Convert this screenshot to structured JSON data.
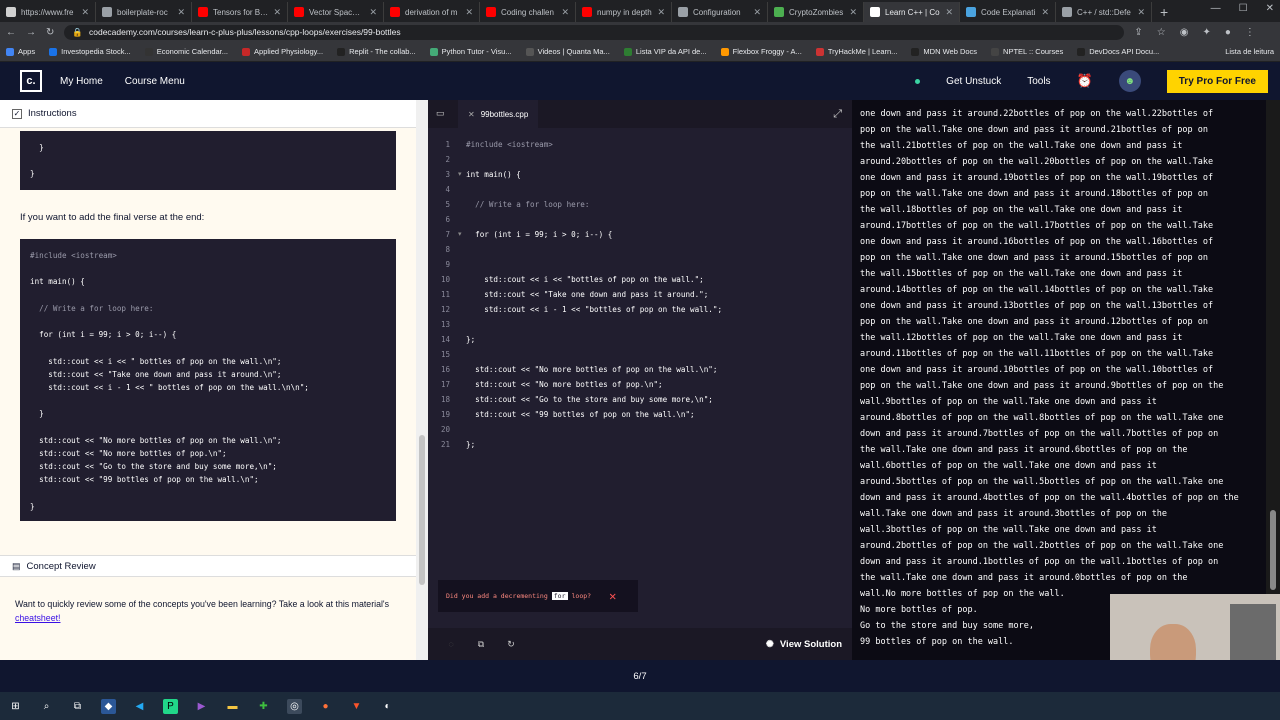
{
  "browser": {
    "tabs": [
      {
        "label": "https://www.fre",
        "color": "#d0d0d0"
      },
      {
        "label": "boilerplate-roc",
        "color": "#9aa0a6"
      },
      {
        "label": "Tensors for Begi",
        "color": "#ff0000"
      },
      {
        "label": "Vector Space M",
        "color": "#ff0000"
      },
      {
        "label": "derivation of m",
        "color": "#ff0000"
      },
      {
        "label": "Coding challen",
        "color": "#ff0000"
      },
      {
        "label": "numpy in depth",
        "color": "#ff0000"
      },
      {
        "label": "Configuration",
        "color": "#9aa0a6"
      },
      {
        "label": "CryptoZombies",
        "color": "#4caf50"
      },
      {
        "label": "Learn C++ | Co",
        "color": "#ffffff"
      },
      {
        "label": "Code Explanati",
        "color": "#4aa3df"
      },
      {
        "label": "C++ / std::Defe",
        "color": "#9aa0a6"
      }
    ],
    "url": "codecademy.com/courses/learn-c-plus-plus/lessons/cpp-loops/exercises/99-bottles",
    "bookmarks": [
      "Apps",
      "Investopedia Stock...",
      "Economic Calendar...",
      "Applied Physiology...",
      "Replit - The collab...",
      "Python Tutor - Visu...",
      "Videos | Quanta Ma...",
      "Lista VIP da API de...",
      "Flexbox Froggy - A...",
      "TryHackMe | Learn...",
      "MDN Web Docs",
      "NPTEL :: Courses",
      "DevDocs API Docu..."
    ],
    "bookmark_right": "Lista de leitura"
  },
  "header": {
    "logo": "c.",
    "home": "My Home",
    "menu": "Course Menu",
    "unstuck": "Get Unstuck",
    "tools": "Tools",
    "pro": "Try Pro For Free"
  },
  "instructions": {
    "title": "Instructions",
    "prev_block": [
      "  }",
      "",
      "}"
    ],
    "final_verse_text": "If you want to add the final verse at the end:",
    "code": [
      "#include <iostream>",
      "",
      "int main() {",
      "",
      "  // Write a for loop here:",
      "",
      "  for (int i = 99; i > 0; i--) {",
      "",
      "    std::cout << i << \" bottles of pop on the wall.\\n\";",
      "    std::cout << \"Take one down and pass it around.\\n\";",
      "    std::cout << i - 1 << \" bottles of pop on the wall.\\n\\n\";",
      "",
      "  }",
      "",
      "  std::cout << \"No more bottles of pop on the wall.\\n\";",
      "  std::cout << \"No more bottles of pop.\\n\";",
      "  std::cout << \"Go to the store and buy some more,\\n\";",
      "  std::cout << \"99 bottles of pop on the wall.\\n\";",
      "",
      "}"
    ],
    "concept_title": "Concept Review",
    "concept_text": "Want to quickly review some of the concepts you've been learning? Take a look at this material's",
    "concept_link": "cheatsheet!"
  },
  "editor": {
    "filename": "99bottles.cpp",
    "lines": [
      "#include <iostream>",
      "",
      "int main() {",
      "",
      "  // Write a for loop here:",
      "",
      "  for (int i = 99; i > 0; i--) {",
      "",
      "",
      "    std::cout << i << \"bottles of pop on the wall.\";",
      "    std::cout << \"Take one down and pass it around.\";",
      "    std::cout << i - 1 << \"bottles of pop on the wall.\";",
      "",
      "};",
      "",
      "  std::cout << \"No more bottles of pop on the wall.\\n\";",
      "  std::cout << \"No more bottles of pop.\\n\";",
      "  std::cout << \"Go to the store and buy some more,\\n\";",
      "  std::cout << \"99 bottles of pop on the wall.\\n\";",
      "",
      "};"
    ],
    "line_numbers": [
      "1",
      "2",
      "3",
      "4",
      "5",
      "6",
      "7",
      "8",
      "9",
      "10",
      "11",
      "12",
      "13",
      "14",
      "15",
      "16",
      "17",
      "18",
      "19",
      "20",
      "21"
    ],
    "hint_pre": "Did you add a decrementing",
    "hint_kw": "for",
    "hint_post": "loop?",
    "view_solution": "View Solution"
  },
  "output": {
    "text": "one down and pass it around.22bottles of pop on the wall.22bottles of\npop on the wall.Take one down and pass it around.21bottles of pop on\nthe wall.21bottles of pop on the wall.Take one down and pass it\naround.20bottles of pop on the wall.20bottles of pop on the wall.Take\none down and pass it around.19bottles of pop on the wall.19bottles of\npop on the wall.Take one down and pass it around.18bottles of pop on\nthe wall.18bottles of pop on the wall.Take one down and pass it\naround.17bottles of pop on the wall.17bottles of pop on the wall.Take\none down and pass it around.16bottles of pop on the wall.16bottles of\npop on the wall.Take one down and pass it around.15bottles of pop on\nthe wall.15bottles of pop on the wall.Take one down and pass it\naround.14bottles of pop on the wall.14bottles of pop on the wall.Take\none down and pass it around.13bottles of pop on the wall.13bottles of\npop on the wall.Take one down and pass it around.12bottles of pop on\nthe wall.12bottles of pop on the wall.Take one down and pass it\naround.11bottles of pop on the wall.11bottles of pop on the wall.Take\none down and pass it around.10bottles of pop on the wall.10bottles of\npop on the wall.Take one down and pass it around.9bottles of pop on the\nwall.9bottles of pop on the wall.Take one down and pass it\naround.8bottles of pop on the wall.8bottles of pop on the wall.Take one\ndown and pass it around.7bottles of pop on the wall.7bottles of pop on\nthe wall.Take one down and pass it around.6bottles of pop on the\nwall.6bottles of pop on the wall.Take one down and pass it\naround.5bottles of pop on the wall.5bottles of pop on the wall.Take one\ndown and pass it around.4bottles of pop on the wall.4bottles of pop on the\nwall.Take one down and pass it around.3bottles of pop on the\nwall.3bottles of pop on the wall.Take one down and pass it\naround.2bottles of pop on the wall.2bottles of pop on the wall.Take one\ndown and pass it around.1bottles of pop on the wall.1bottles of pop on\nthe wall.Take one down and pass it around.0bottles of pop on the\nwall.No more bottles of pop on the wall.\nNo more bottles of pop.\nGo to the store and buy some more,\n99 bottles of pop on the wall."
  },
  "footer": {
    "progress": "6/7"
  },
  "colors": {
    "brand_navy": "#10162f",
    "pro_yellow": "#ffd300",
    "editor_bg": "#211e2f"
  }
}
